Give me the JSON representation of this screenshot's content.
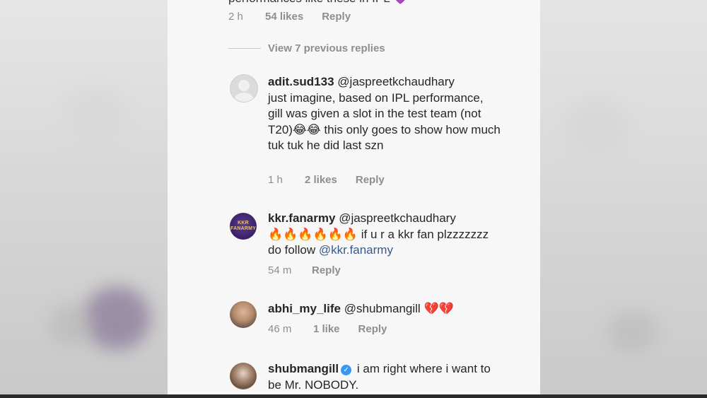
{
  "top_fragment": {
    "text": "performances like these in IPL 💜"
  },
  "top_meta": {
    "time": "2 h",
    "likes": "54 likes",
    "reply": "Reply"
  },
  "view_replies": "View 7 previous replies",
  "comments": [
    {
      "username": "adit.sud133",
      "mention": "@jaspreetkchaudhary",
      "text": "just imagine, based on IPL performance, gill was given a slot in the test team (not T20)😂😂 this only goes to show how much tuk tuk he did last szn",
      "time": "1 h",
      "likes": "2 likes",
      "reply": "Reply",
      "avatar": "default-avatar-icon"
    },
    {
      "username": "kkr.fanarmy",
      "mention": "@jaspreetkchaudhary",
      "text_prefix": "🔥🔥🔥🔥🔥🔥 if u r a kkr fan plzzzzzzz do follow ",
      "text_link": "@kkr.fanarmy",
      "time": "54 m",
      "likes": "",
      "reply": "Reply",
      "avatar_label": "KKR FANARMY"
    },
    {
      "username": "abhi_my_life",
      "mention": "@shubmangill",
      "text": "💔💔",
      "time": "46 m",
      "likes": "1 like",
      "reply": "Reply"
    },
    {
      "username": "shubmangill",
      "verified": "✓",
      "text": "i am right where i want to be Mr. NOBODY."
    }
  ]
}
